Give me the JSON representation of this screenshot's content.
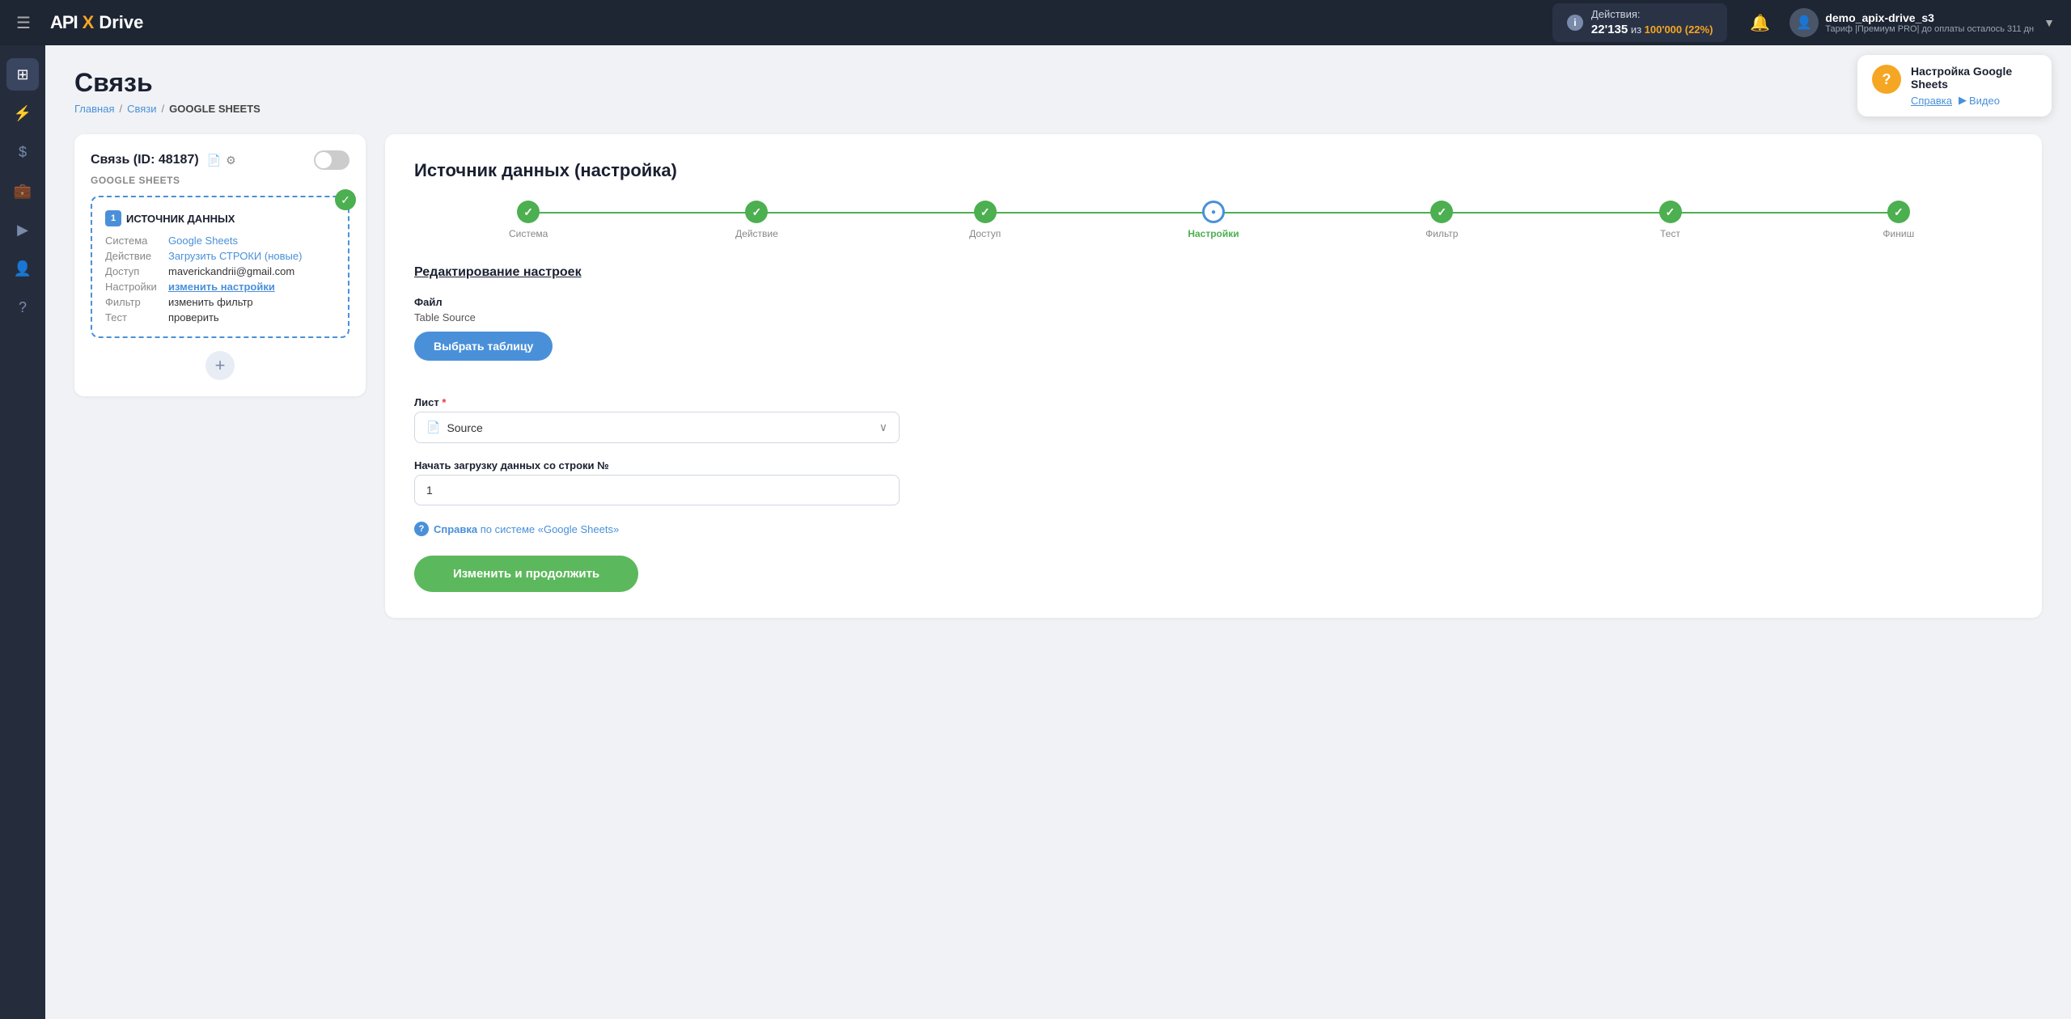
{
  "topnav": {
    "hamburger": "☰",
    "logo_api": "API",
    "logo_x": "X",
    "logo_drive": "Drive",
    "actions_label": "Действия:",
    "actions_count": "22'135",
    "actions_separator": "из",
    "actions_limit": "100'000 (22%)",
    "bell_icon": "🔔",
    "user_avatar_icon": "👤",
    "user_name": "demo_apix-drive_s3",
    "user_plan": "Тариф |Премиум PRO| до оплаты осталось 311 дн",
    "chevron_icon": "▼"
  },
  "sidebar": {
    "items": [
      {
        "icon": "⊞",
        "name": "dashboard"
      },
      {
        "icon": "⚡",
        "name": "connections"
      },
      {
        "icon": "$",
        "name": "billing"
      },
      {
        "icon": "💼",
        "name": "services"
      },
      {
        "icon": "▶",
        "name": "youtube"
      },
      {
        "icon": "👤",
        "name": "account"
      },
      {
        "icon": "?",
        "name": "help"
      }
    ]
  },
  "page": {
    "title": "Связь",
    "breadcrumb": {
      "home": "Главная",
      "connections": "Связи",
      "current": "GOOGLE SHEETS"
    }
  },
  "help_box": {
    "icon": "?",
    "title": "Настройка Google Sheets",
    "link_help": "Справка",
    "video_icon": "▶",
    "link_video": "Видео"
  },
  "left_panel": {
    "connection_title": "Связь (ID: 48187)",
    "doc_icon": "📄",
    "gear_icon": "⚙",
    "google_sheets_label": "GOOGLE SHEETS",
    "source_card": {
      "badge": "1",
      "label": "ИСТОЧНИК ДАННЫХ",
      "rows": [
        {
          "key": "Система",
          "val": "Google Sheets",
          "is_link": true
        },
        {
          "key": "Действие",
          "val": "Загрузить СТРОКИ (новые)",
          "is_link": true
        },
        {
          "key": "Доступ",
          "val": "maverickandrii@gmail.com",
          "is_link": false
        },
        {
          "key": "Настройки",
          "val": "изменить настройки",
          "is_link": true,
          "underline": true
        },
        {
          "key": "Фильтр",
          "val": "изменить фильтр",
          "is_link": false
        },
        {
          "key": "Тест",
          "val": "проверить",
          "is_link": false
        }
      ]
    },
    "add_icon": "+"
  },
  "right_panel": {
    "title": "Источник данных (настройка)",
    "steps": [
      {
        "label": "Система",
        "state": "done"
      },
      {
        "label": "Действие",
        "state": "done"
      },
      {
        "label": "Доступ",
        "state": "done"
      },
      {
        "label": "Настройки",
        "state": "active"
      },
      {
        "label": "Фильтр",
        "state": "done"
      },
      {
        "label": "Тест",
        "state": "done"
      },
      {
        "label": "Финиш",
        "state": "done"
      }
    ],
    "edit_heading": "Редактирование настроек",
    "file_label": "Файл",
    "file_name": "Table Source",
    "select_table_btn": "Выбрать таблицу",
    "sheet_label": "Лист",
    "sheet_required": "*",
    "sheet_selected": "Source",
    "doc_icon": "📄",
    "chevron_icon": "∨",
    "start_row_label": "Начать загрузку данных со строки №",
    "start_row_value": "1",
    "help_prefix": "Справка",
    "help_suffix": " по системе «Google Sheets»",
    "save_btn": "Изменить и продолжить"
  }
}
